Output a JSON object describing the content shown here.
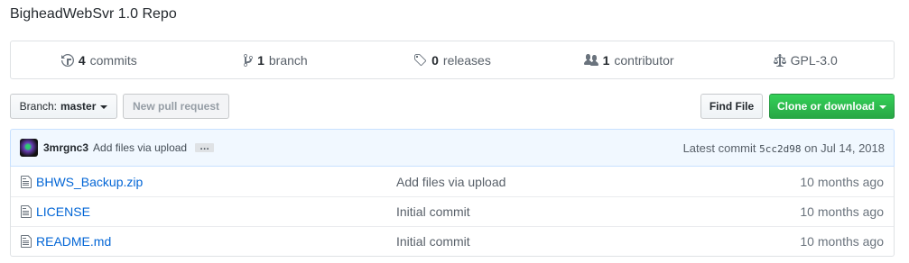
{
  "repo": {
    "description": "BigheadWebSvr 1.0 Repo"
  },
  "summary": {
    "commits_count": "4",
    "commits_label": "commits",
    "branches_count": "1",
    "branches_label": "branch",
    "releases_count": "0",
    "releases_label": "releases",
    "contributors_count": "1",
    "contributors_label": "contributor",
    "license": "GPL-3.0"
  },
  "toolbar": {
    "branch_prefix": "Branch:",
    "branch_name": "master",
    "new_pr_label": "New pull request",
    "find_file_label": "Find File",
    "clone_label": "Clone or download"
  },
  "commit": {
    "author": "3mrgnc3",
    "message": "Add files via upload",
    "ellipsis": "…",
    "latest_prefix": "Latest commit",
    "sha": "5cc2d98",
    "date_text": "on Jul 14, 2018"
  },
  "files": [
    {
      "name": "BHWS_Backup.zip",
      "message": "Add files via upload",
      "age": "10 months ago"
    },
    {
      "name": "LICENSE",
      "message": "Initial commit",
      "age": "10 months ago"
    },
    {
      "name": "README.md",
      "message": "Initial commit",
      "age": "10 months ago"
    }
  ],
  "icons": {
    "commits": "history-icon",
    "branch": "git-branch-icon",
    "releases": "tag-icon",
    "contributors": "people-icon",
    "license": "law-icon",
    "file": "file-icon"
  },
  "colors": {
    "accent": "#28a745",
    "link": "#0366d6",
    "commit_bar_bg": "#f1f8ff",
    "commit_bar_border": "#c8e1ff"
  }
}
